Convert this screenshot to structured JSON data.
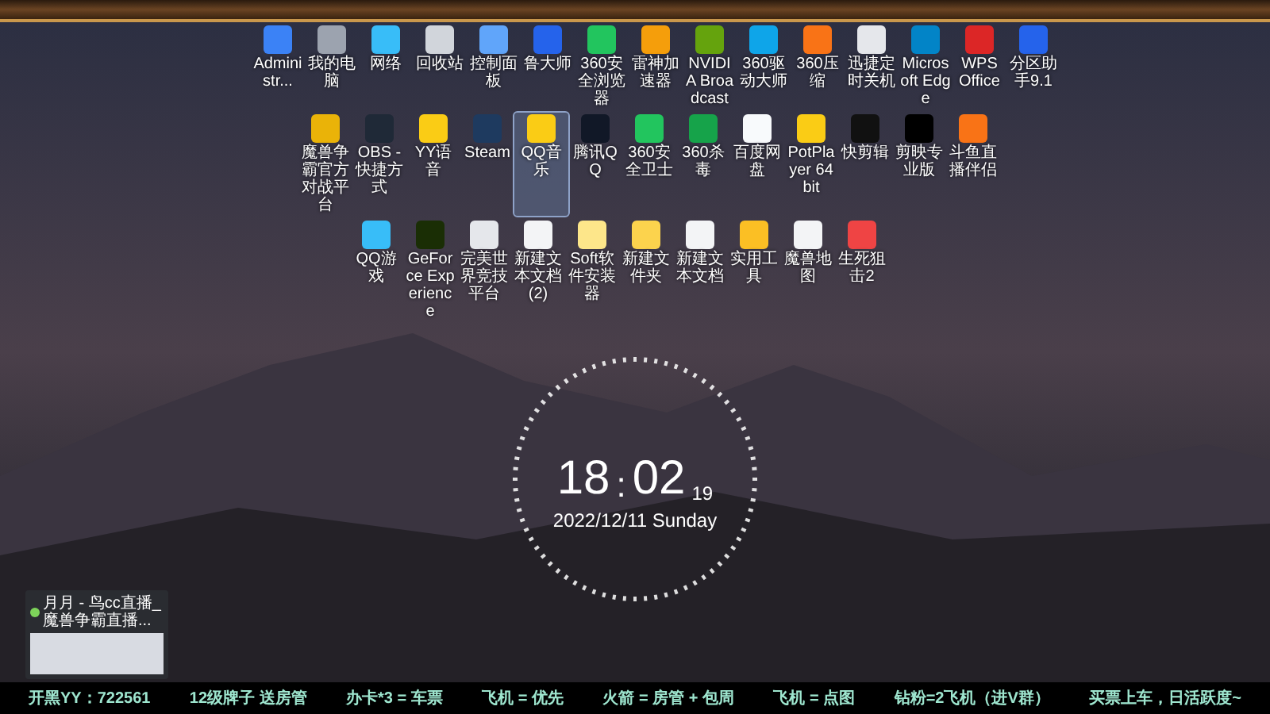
{
  "desktop_icons": [
    [
      {
        "label": "Administr...",
        "color": "#3b82f6",
        "selected": false
      },
      {
        "label": "我的电脑",
        "color": "#9ca3af",
        "selected": false
      },
      {
        "label": "网络",
        "color": "#38bdf8",
        "selected": false
      },
      {
        "label": "回收站",
        "color": "#d1d5db",
        "selected": false
      },
      {
        "label": "控制面板",
        "color": "#60a5fa",
        "selected": false
      },
      {
        "label": "鲁大师",
        "color": "#2563eb",
        "selected": false
      },
      {
        "label": "360安全浏览器",
        "color": "#22c55e",
        "selected": false
      },
      {
        "label": "雷神加速器",
        "color": "#f59e0b",
        "selected": false
      },
      {
        "label": "NVIDIA Broadcast",
        "color": "#65a30d",
        "selected": false
      },
      {
        "label": "360驱动大师",
        "color": "#0ea5e9",
        "selected": false
      },
      {
        "label": "360压缩",
        "color": "#f97316",
        "selected": false
      },
      {
        "label": "迅捷定时关机",
        "color": "#e5e7eb",
        "selected": false
      },
      {
        "label": "Microsoft Edge",
        "color": "#0284c7",
        "selected": false
      },
      {
        "label": "WPS Office",
        "color": "#dc2626",
        "selected": false
      },
      {
        "label": "分区助手9.1",
        "color": "#2563eb",
        "selected": false
      }
    ],
    [
      {
        "label": "魔兽争霸官方对战平台",
        "color": "#eab308",
        "selected": false
      },
      {
        "label": "OBS - 快捷方式",
        "color": "#1f2937",
        "selected": false
      },
      {
        "label": "YY语音",
        "color": "#facc15",
        "selected": false
      },
      {
        "label": "Steam",
        "color": "#1e3a5f",
        "selected": false
      },
      {
        "label": "QQ音乐",
        "color": "#facc15",
        "selected": true
      },
      {
        "label": "腾讯QQ",
        "color": "#111827",
        "selected": false
      },
      {
        "label": "360安全卫士",
        "color": "#22c55e",
        "selected": false
      },
      {
        "label": "360杀毒",
        "color": "#16a34a",
        "selected": false
      },
      {
        "label": "百度网盘",
        "color": "#f8fafc",
        "selected": false
      },
      {
        "label": "PotPlayer 64 bit",
        "color": "#facc15",
        "selected": false
      },
      {
        "label": "快剪辑",
        "color": "#111111",
        "selected": false
      },
      {
        "label": "剪映专业版",
        "color": "#000000",
        "selected": false
      },
      {
        "label": "斗鱼直播伴侣",
        "color": "#f97316",
        "selected": false
      }
    ],
    [
      {
        "label": "QQ游戏",
        "color": "#38bdf8",
        "selected": false
      },
      {
        "label": "GeForce Experience",
        "color": "#1a2e05",
        "selected": false
      },
      {
        "label": "完美世界竞技平台",
        "color": "#e5e7eb",
        "selected": false
      },
      {
        "label": "新建文本文档 (2)",
        "color": "#f3f4f6",
        "selected": false
      },
      {
        "label": "Soft软件安装器",
        "color": "#fde68a",
        "selected": false
      },
      {
        "label": "新建文件夹",
        "color": "#fcd34d",
        "selected": false
      },
      {
        "label": "新建文本文档",
        "color": "#f3f4f6",
        "selected": false
      },
      {
        "label": "实用工具",
        "color": "#fbbf24",
        "selected": false
      },
      {
        "label": "魔兽地图",
        "color": "#f3f4f6",
        "selected": false
      },
      {
        "label": "生死狙击2",
        "color": "#ef4444",
        "selected": false
      }
    ]
  ],
  "clock": {
    "hours": "18",
    "separator": ":",
    "minutes": "02",
    "seconds": "19",
    "date": "2022/12/11 Sunday"
  },
  "task_preview": {
    "title": "月月 - 鸟cc直播_魔兽争霸直播..."
  },
  "ticker": [
    "开黑YY：722561",
    "12级牌子 送房管",
    "办卡*3 = 车票",
    "飞机 = 优先",
    "火箭 = 房管 + 包周",
    "飞机 = 点图",
    "钻粉=2飞机（进V群）",
    "买票上车，日活跃度~"
  ]
}
